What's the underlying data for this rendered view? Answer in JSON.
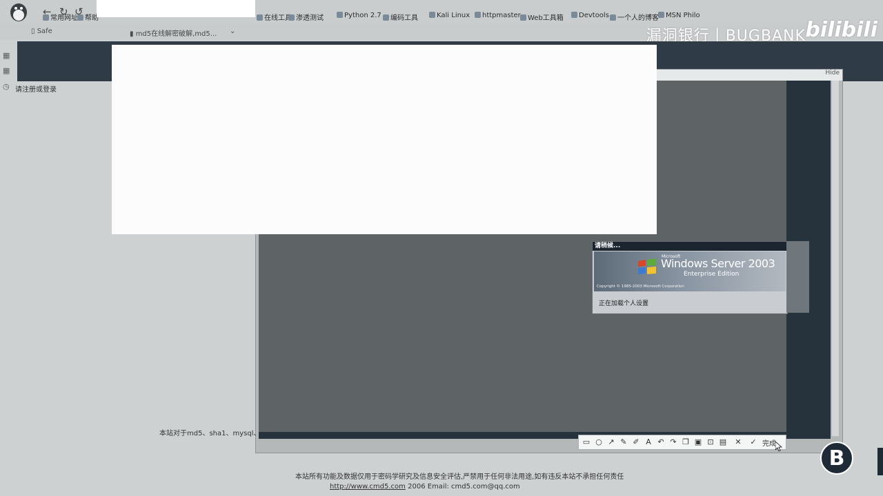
{
  "bookmarks": [
    {
      "label": "常用网址"
    },
    {
      "label": "帮助"
    },
    {
      "label": "在线工具"
    },
    {
      "label": "渗透测试"
    },
    {
      "label": "Python 2.7"
    },
    {
      "label": "编码工具"
    },
    {
      "label": "Kali Linux"
    },
    {
      "label": "httpmaster"
    },
    {
      "label": "Web工具箱"
    },
    {
      "label": "Devtools"
    },
    {
      "label": "一个人的博客"
    },
    {
      "label": "MSN Philo"
    }
  ],
  "tabs": [
    {
      "label": "Safe"
    },
    {
      "label": "md5在线解密破解,md5..."
    }
  ],
  "watermark": {
    "text": "漏洞银行丨BUGBANK",
    "brand": "bilibili"
  },
  "sidebar": {
    "text": "请注册或登录"
  },
  "rdp": {
    "title_button": "Hide",
    "logon": {
      "title": "请稍候...",
      "microsoft": "Microsoft",
      "product": "Windows Server 2003",
      "edition": "Enterprise Edition",
      "copyright": "Copyright © 1985-2003 Microsoft Corporation",
      "status": "正在加载个人设置"
    }
  },
  "snip_toolbar": {
    "tools": [
      "rect-icon",
      "ellipse-icon",
      "arrow-icon",
      "pen-icon",
      "highlighter-icon",
      "text-icon",
      "undo-icon",
      "redo-icon",
      "copy-icon",
      "save-icon",
      "pin-icon",
      "cancel-icon"
    ],
    "done_label": "完成"
  },
  "page": {
    "note": "本站对于md5、sha1、mysql、...",
    "footer_line1": "本站所有功能及数据仅用于密码学研究及信息安全评估,严禁用于任何非法用途,如有违反本站不承担任何责任",
    "footer_url": "http://www.cmd5.com",
    "footer_year": "2006",
    "footer_email": "Email: cmd5.com@qq.com"
  },
  "colors": {
    "dark_band": "#2f3b46",
    "rdp_screen": "#5e6366",
    "cover": "#fbfcfb"
  }
}
